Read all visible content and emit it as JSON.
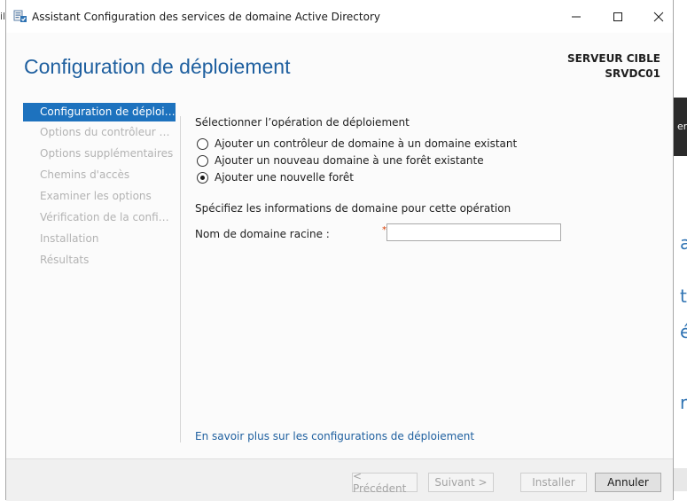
{
  "window": {
    "title": "Assistant Configuration des services de domaine Active Directory"
  },
  "header": {
    "title": "Configuration de déploiement",
    "target_label": "SERVEUR CIBLE",
    "target_name": "SRVDC01"
  },
  "nav": {
    "items": [
      {
        "label": "Configuration de déploie...",
        "state": "active"
      },
      {
        "label": "Options du contrôleur de...",
        "state": "disabled"
      },
      {
        "label": "Options supplémentaires",
        "state": "disabled"
      },
      {
        "label": "Chemins d'accès",
        "state": "disabled"
      },
      {
        "label": "Examiner les options",
        "state": "disabled"
      },
      {
        "label": "Vérification de la configur...",
        "state": "disabled"
      },
      {
        "label": "Installation",
        "state": "disabled"
      },
      {
        "label": "Résultats",
        "state": "disabled"
      }
    ]
  },
  "main": {
    "operation_label": "Sélectionner l’opération de déploiement",
    "options": [
      {
        "label": "Ajouter un contrôleur de domaine à un domaine existant",
        "selected": false
      },
      {
        "label": "Ajouter un nouveau domaine à une forêt existante",
        "selected": false
      },
      {
        "label": "Ajouter une nouvelle forêt",
        "selected": true
      }
    ],
    "domain_info_label": "Spécifiez les informations de domaine pour cette opération",
    "root_domain_label": "Nom de domaine racine :",
    "required_marker": "*",
    "root_domain_value": "",
    "help_link": "En savoir plus sur les configurations de déploiement"
  },
  "footer": {
    "prev_label": "< Précédent",
    "next_label": "Suivant >",
    "install_label": "Installer",
    "cancel_label": "Annuler"
  },
  "background_app": {
    "left_glyph": "il",
    "right_glyphs": [
      "er",
      "a",
      "ti",
      "é",
      "rv"
    ]
  },
  "colors": {
    "accent": "#1d72be",
    "title_blue": "#1e5f9f",
    "required": "#d83b01"
  }
}
